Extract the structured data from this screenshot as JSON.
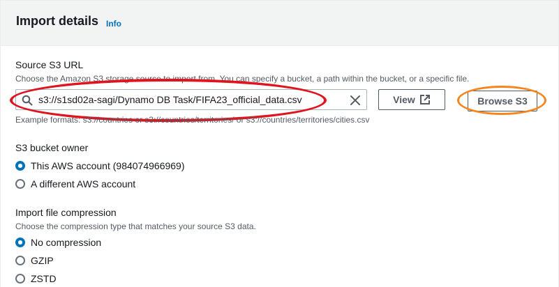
{
  "panel": {
    "title": "Import details",
    "info_link": "Info"
  },
  "source_url": {
    "label": "Source S3 URL",
    "description": "Choose the Amazon S3 storage source to import from. You can specify a bucket, a path within the bucket, or a specific file.",
    "value": "s3://s1sd02a-sagi/Dynamo DB Task/FIFA23_official_data.csv",
    "example": "Example formats: s3://countries or s3://countries/territories/ or s3://countries/territories/cities.csv",
    "view_button": "View",
    "browse_button": "Browse S3"
  },
  "bucket_owner": {
    "label": "S3 bucket owner",
    "options": [
      {
        "label": "This AWS account (984074966969)",
        "checked": true
      },
      {
        "label": "A different AWS account",
        "checked": false
      }
    ]
  },
  "compression": {
    "label": "Import file compression",
    "description": "Choose the compression type that matches your source S3 data.",
    "options": [
      {
        "label": "No compression",
        "checked": true
      },
      {
        "label": "GZIP",
        "checked": false
      },
      {
        "label": "ZSTD",
        "checked": false
      }
    ]
  },
  "icons": {
    "search": "search-icon",
    "clear": "close-icon",
    "external": "external-link-icon"
  },
  "colors": {
    "accent": "#0073bb",
    "annotation_red": "#e0141e",
    "annotation_orange": "#f5861f"
  }
}
